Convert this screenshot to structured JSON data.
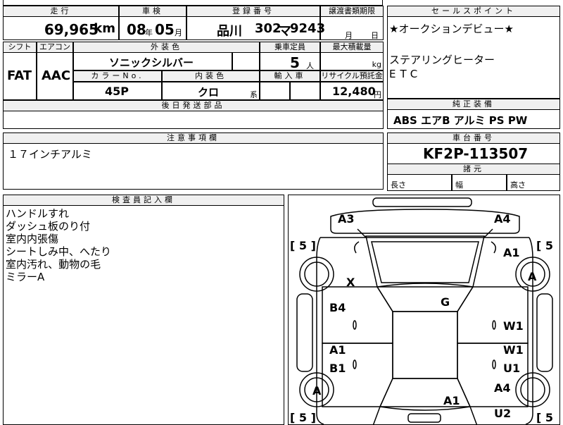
{
  "header": {
    "mileage_label": "走行",
    "inspection_label": "車検",
    "registration_label": "登録番号",
    "transfer_label": "譲渡書類期限",
    "sales_point_label": "セールスポイント"
  },
  "values": {
    "mileage": "69,965",
    "mileage_unit": "km",
    "inspection_year": "08",
    "inspection_year_unit": "年",
    "inspection_month": "05",
    "inspection_month_unit": "月",
    "registration_region": "品川",
    "registration_class": "302",
    "registration_kana": "マ",
    "registration_number": "9243",
    "transfer_month_unit": "月",
    "transfer_day_unit": "日"
  },
  "spec": {
    "shift_label": "シフト",
    "aircon_label": "エアコン",
    "exterior_label": "外装色",
    "capacity_label": "乗車定員",
    "maxload_label": "最大積載量",
    "shift": "FAT",
    "aircon": "AAC",
    "exterior": "ソニックシルバー",
    "capacity": "5",
    "capacity_unit": "人",
    "maxload_unit": "kg",
    "color_no_label": "カラーNo.",
    "interior_label": "内装色",
    "import_label": "輸入車",
    "recycle_label": "リサイクル預託金",
    "color_no": "45P",
    "interior": "クロ",
    "interior_unit": "系",
    "recycle": "12,480",
    "recycle_unit": "円",
    "later_parts_label": "後日発送部品"
  },
  "sales_points": [
    "★オークションデビュー★",
    "ステアリングヒーター",
    "ETC"
  ],
  "equipment": {
    "label": "純正装備",
    "items": "ABS エアB アルミ PS PW"
  },
  "caution": {
    "label": "注意事項欄",
    "text": "１７インチアルミ"
  },
  "chassis": {
    "label": "車台番号",
    "number": "KF2P-113507"
  },
  "dimensions": {
    "label": "諸元",
    "length": "長さ",
    "width": "幅",
    "height": "高さ"
  },
  "inspector": {
    "label": "検査員記入欄",
    "notes": [
      "ハンドルすれ",
      "ダッシュ板のり付",
      "室内内張傷",
      "シートしみ中、へたり",
      "室内汚れ、動物の毛",
      "ミラーA"
    ]
  },
  "diagram": {
    "marks": {
      "a3": "A3",
      "a4_top": "A4",
      "a1_right": "A1",
      "a_right": "A",
      "x": "X",
      "g": "G",
      "b4": "B4",
      "w1_upper": "W1",
      "a1_left": "A1",
      "w1_lower": "W1",
      "b1": "B1",
      "u1": "U1",
      "a_left": "A",
      "a4_right": "A4",
      "a1_bottom": "A1",
      "u2": "U2"
    },
    "tread": {
      "fl": "5",
      "fr": "5",
      "rl": "5",
      "rr": "5"
    }
  }
}
